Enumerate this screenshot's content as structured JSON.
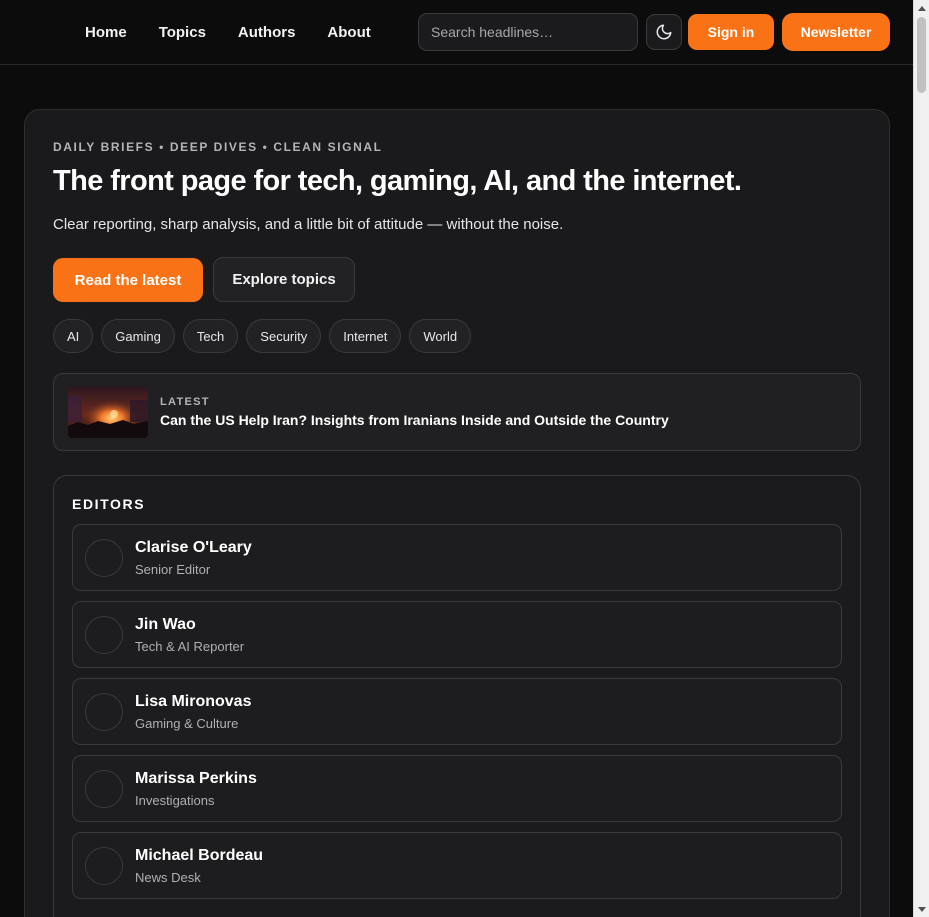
{
  "nav": {
    "items": [
      {
        "label": "Home"
      },
      {
        "label": "Topics"
      },
      {
        "label": "Authors"
      },
      {
        "label": "About"
      }
    ],
    "search_placeholder": "Search headlines…",
    "theme_icon": "moon-icon",
    "signin_label": "Sign in",
    "newsletter_label": "Newsletter"
  },
  "hero": {
    "eyebrow": "DAILY BRIEFS • DEEP DIVES • CLEAN SIGNAL",
    "headline": "The front page for tech, gaming, AI, and the internet.",
    "subline": "Clear reporting, sharp analysis, and a little bit of attitude — without the noise.",
    "read_label": "Read the latest",
    "explore_label": "Explore topics",
    "topics": [
      "AI",
      "Gaming",
      "Tech",
      "Security",
      "Internet",
      "World"
    ]
  },
  "latest": {
    "kicker": "LATEST",
    "title": "Can the US Help Iran? Insights from Iranians Inside and Outside the Country"
  },
  "editors": {
    "title": "EDITORS",
    "items": [
      {
        "name": "Clarise O'Leary",
        "role": "Senior Editor"
      },
      {
        "name": "Jin Wao",
        "role": "Tech & AI Reporter"
      },
      {
        "name": "Lisa Mironovas",
        "role": "Gaming & Culture"
      },
      {
        "name": "Marissa Perkins",
        "role": "Investigations"
      },
      {
        "name": "Michael Bordeau",
        "role": "News Desk"
      }
    ]
  },
  "colors": {
    "accent": "#f97316",
    "background": "#0c0c0d",
    "card": "#1a1a1c"
  }
}
